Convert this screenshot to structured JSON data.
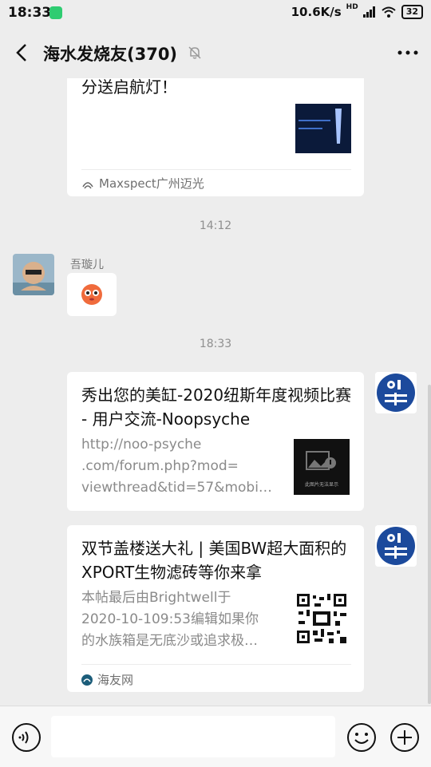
{
  "status": {
    "time": "18:33",
    "speed": "10.6K/s",
    "network": "HD",
    "battery": "32"
  },
  "header": {
    "title": "海水发烧友(370)"
  },
  "messages": {
    "card1": {
      "title_tail": "分送启航灯！",
      "source": "Maxspect广州迈光"
    },
    "time1": "14:12",
    "user": {
      "name": "吾璇儿"
    },
    "time2": "18:33",
    "card2": {
      "title": "秀出您的美缸-2020纽斯年度视频比赛 - 用户交流-Noopsyche",
      "desc": "http://noo-psyche\n.com/forum.php?mod=\nviewthread&tid=57&mobi…",
      "thumb_caption": "此图片无法显示"
    },
    "card3": {
      "title": "双节盖楼送大礼 | 美国BW超大面积的XPORT生物滤砖等你来拿",
      "desc": "本帖最后由Brightwell于\n2020-10-109:53编辑如果你\n的水族箱是无底沙或追求极…",
      "source": "海友网"
    }
  },
  "colors": {
    "background": "#ededed",
    "card": "#ffffff",
    "brand_blue": "#1c4a9c"
  },
  "icons": {
    "back": "chevron-left-icon",
    "mute": "bell-off-icon",
    "more": "more-dots-icon",
    "voice": "voice-icon",
    "emoji": "emoji-icon",
    "plus": "plus-icon"
  }
}
